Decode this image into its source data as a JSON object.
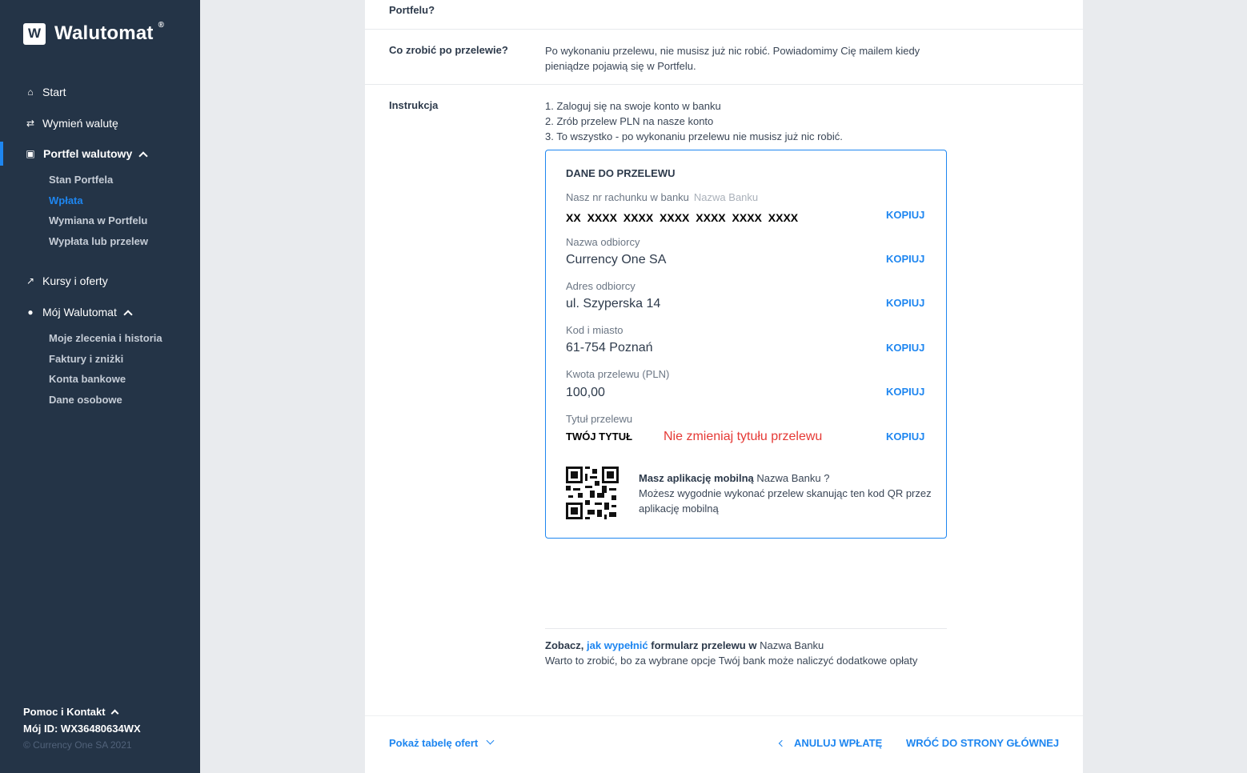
{
  "sidebar": {
    "logo_letter": "W",
    "logo_text": "Walutomat",
    "logo_reg": "®",
    "nav": [
      {
        "icon": "home-icon",
        "glyph": "⌂",
        "label": "Start"
      },
      {
        "icon": "exchange-icon",
        "glyph": "⇄",
        "label": "Wymień walutę"
      },
      {
        "icon": "wallet-icon",
        "glyph": "▣",
        "label": "Portfel walutowy"
      },
      {
        "icon": "trend-icon",
        "glyph": "↗",
        "label": "Kursy i oferty"
      },
      {
        "icon": "user-icon",
        "glyph": "●",
        "label": "Mój Walutomat"
      }
    ],
    "wallet_sub": [
      "Stan Portfela",
      "Wpłata",
      "Wymiana w Portfelu",
      "Wypłata lub przelew"
    ],
    "account_sub": [
      "Moje zlecenia i historia",
      "Faktury i zniżki",
      "Konta bankowe",
      "Dane osobowe"
    ],
    "help": "Pomoc i Kontakt",
    "my_id": "Mój ID: WX36480634WX",
    "copyright": "© Currency One SA 2021"
  },
  "main": {
    "top_label": "Portfelu?",
    "after_label": "Co zrobić po przelewie?",
    "after_text_1": "Po wykonaniu przelewu, nie musisz już nic robić. Powiadomimy Cię mailem kiedy",
    "after_text_2": "pieniądze pojawią się w Portfelu.",
    "instr_label": "Instrukcja",
    "instr_1": "1. Zaloguj się na swoje konto w banku",
    "instr_2": "2. Zrób przelew PLN na nasze konto",
    "instr_3": "3. To wszystko - po wykonaniu przelewu nie musisz już nic robić."
  },
  "transfer": {
    "title": "DANE DO PRZELEWU",
    "copy_label": "KOPIUJ",
    "account_label": "Nasz nr rachunku w banku",
    "bank_name": "Nazwa Banku",
    "account_value": "XX XXXX XXXX XXXX XXXX XXXX XXXX",
    "recipient_label": "Nazwa odbiorcy",
    "recipient_value": "Currency One SA",
    "address_label": "Adres odbiorcy",
    "address_value": "ul. Szyperska 14",
    "city_label": "Kod i miasto",
    "city_value": "61-754 Poznań",
    "amount_label": "Kwota przelewu (PLN)",
    "amount_value": "100,00",
    "title_label": "Tytuł przelewu",
    "title_value": "TWÓJ TYTUŁ",
    "title_warning": "Nie zmieniaj tytułu przelewu",
    "qr_heading": "Masz aplikację mobilną",
    "qr_bank": "Nazwa Banku ?",
    "qr_text_1": "Możesz wygodnie wykonać przelew skanując ten kod QR przez",
    "qr_text_2": "aplikację mobilną"
  },
  "how": {
    "prefix": "Zobacz,",
    "link": "jak wypełnić",
    "suffix": "formularz przelewu w",
    "bank": "Nazwa Banku",
    "note": "Warto to zrobić, bo za wybrane opcje Twój bank może naliczyć dodatkowe opłaty"
  },
  "footer": {
    "show_offers": "Pokaż tabelę ofert",
    "cancel": "ANULUJ WPŁATĘ",
    "home": "WRÓĆ DO STRONY GŁÓWNEJ"
  },
  "colors": {
    "sidebar_bg": "#243447",
    "accent": "#1e86f0",
    "warning": "#e53935"
  }
}
